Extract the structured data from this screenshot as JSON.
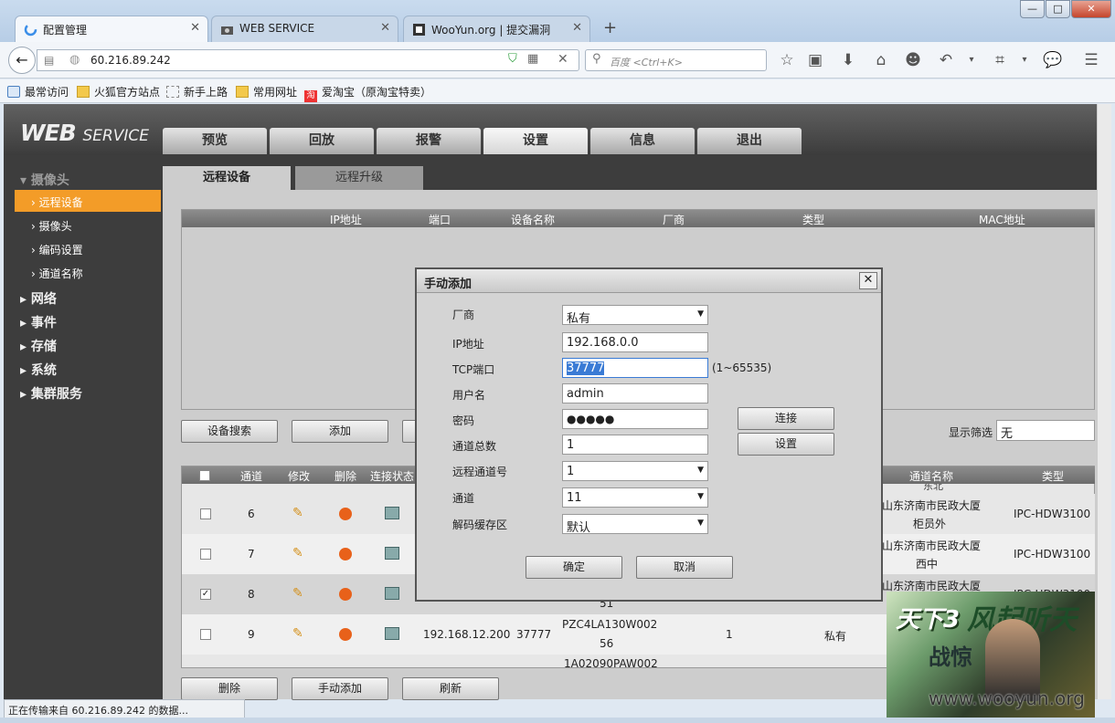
{
  "browser": {
    "tabs": [
      {
        "label": "配置管理"
      },
      {
        "label": "WEB SERVICE"
      },
      {
        "label": "WooYun.org | 提交漏洞"
      }
    ],
    "url": "60.216.89.242",
    "search_placeholder": "百度 <Ctrl+K>",
    "bookmarks": [
      "最常访问",
      "火狐官方站点",
      "新手上路",
      "常用网址",
      "爱淘宝（原淘宝特卖）"
    ],
    "status": "正在传输来自 60.216.89.242 的数据..."
  },
  "app": {
    "logo_main": "WEB",
    "logo_sub": "SERVICE",
    "main_tabs": [
      "预览",
      "回放",
      "报警",
      "设置",
      "信息",
      "退出"
    ],
    "active_tab": "设置",
    "sidebar": {
      "camera": "摄像头",
      "sub": [
        "远程设备",
        "摄像头",
        "编码设置",
        "通道名称"
      ],
      "sections": [
        "网络",
        "事件",
        "存储",
        "系统",
        "集群服务"
      ]
    },
    "sub_tabs": [
      "远程设备",
      "远程升级"
    ],
    "device_columns": [
      "IP地址",
      "端口",
      "设备名称",
      "厂商",
      "类型",
      "MAC地址"
    ],
    "buttons_top": [
      "设备搜索",
      "添加"
    ],
    "filter_label": "显示筛选",
    "filter_value": "无",
    "channel_columns": [
      "通道",
      "修改",
      "删除",
      "连接状态",
      "通道名称",
      "类型"
    ],
    "partial_text": "东北",
    "rows": [
      {
        "ch": "6",
        "name1": "山东济南市民政大厦",
        "name2": "柜员外",
        "type": "IPC-HDW3100",
        "checked": false
      },
      {
        "ch": "7",
        "name1": "山东济南市民政大厦",
        "name2": "西中",
        "type": "IPC-HDW3100",
        "checked": false
      },
      {
        "ch": "8",
        "name1": "山东济南市民政大厦",
        "name2": "",
        "type": "IPC-HDW3100",
        "checked": true,
        "devname2": "51"
      },
      {
        "ch": "9",
        "ip": "192.168.12.200",
        "port": "37777",
        "devname": "PZC4LA130W002",
        "devname2": "56",
        "num": "1",
        "vendor": "私有",
        "checked": false
      }
    ],
    "row10_partial": "1A02090PAW002",
    "buttons_bottom": [
      "删除",
      "手动添加",
      "刷新"
    ]
  },
  "dialog": {
    "title": "手动添加",
    "labels": [
      "厂商",
      "IP地址",
      "TCP端口",
      "用户名",
      "密码",
      "通道总数",
      "远程通道号",
      "通道",
      "解码缓存区"
    ],
    "values": {
      "vendor": "私有",
      "ip": "192.168.0.0",
      "port": "37777",
      "port_range": "(1~65535)",
      "user": "admin",
      "password": "●●●●●",
      "total": "1",
      "remote_ch": "1",
      "channel": "11",
      "buffer": "默认"
    },
    "connect": "连接",
    "setting": "设置",
    "ok": "确定",
    "cancel": "取消"
  },
  "ad": {
    "brand": "天下3",
    "slogan": "风起听天",
    "slogan2": "战惊",
    "watermark": "www.wooyun.org"
  }
}
